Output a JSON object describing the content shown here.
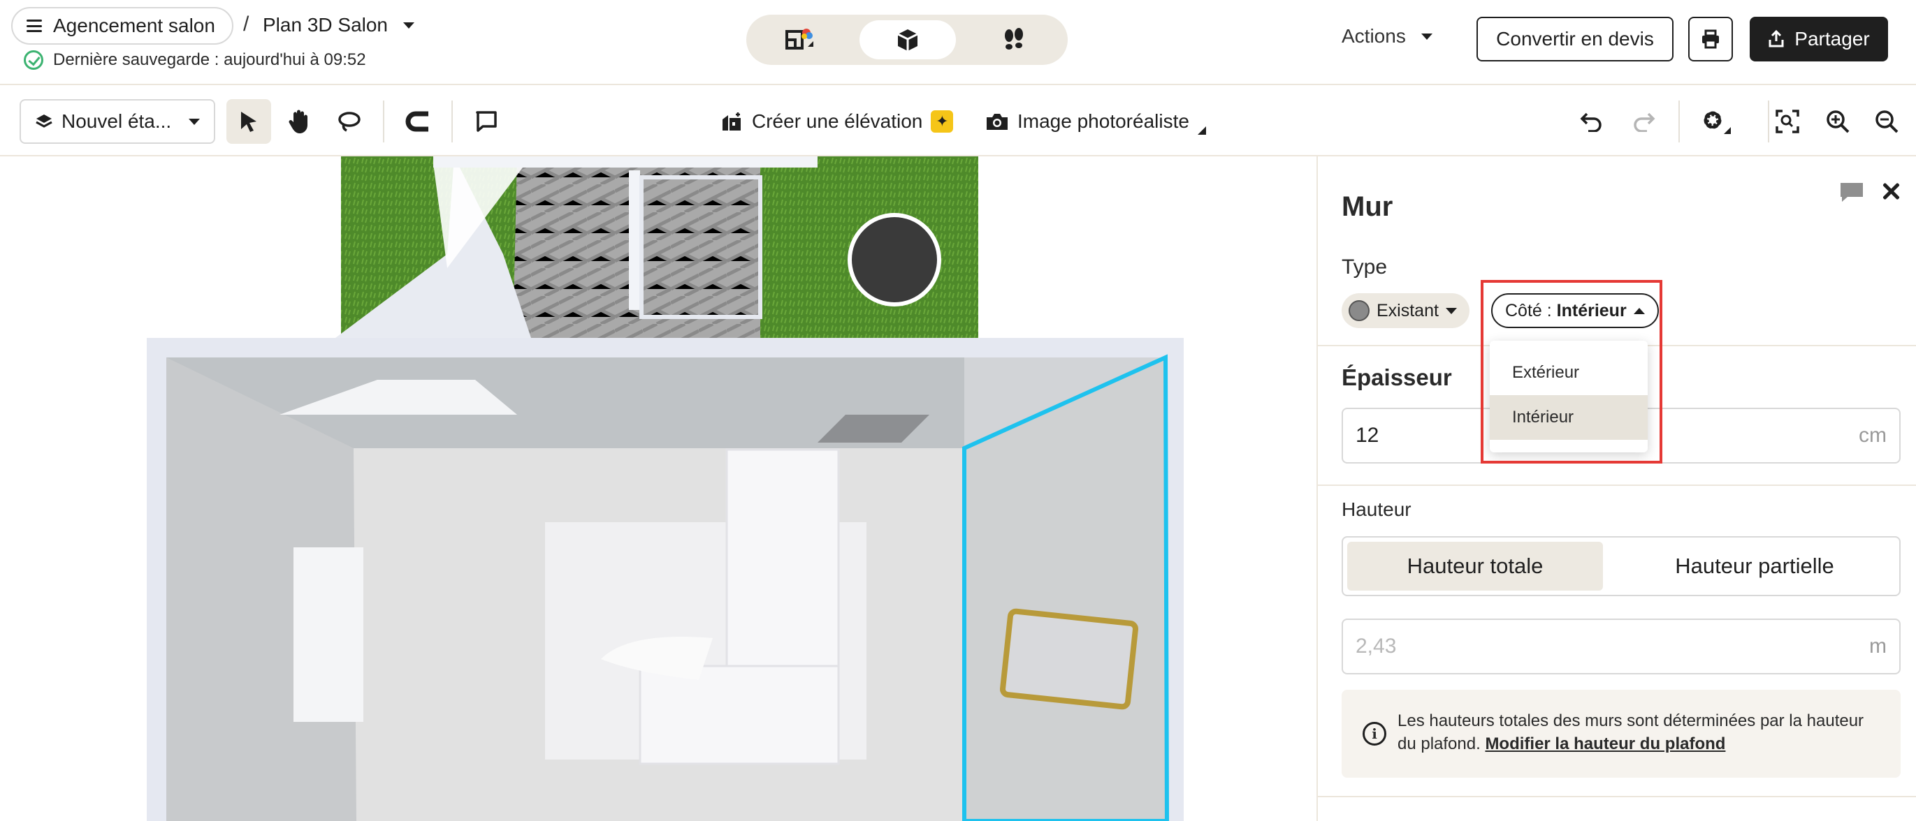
{
  "header": {
    "project_name": "Agencement salon",
    "separator": "/",
    "plan_name": "Plan 3D Salon",
    "save_status": "Dernière sauvegarde : aujourd'hui à 09:52",
    "actions_label": "Actions",
    "convert_label": "Convertir en devis",
    "share_label": "Partager"
  },
  "toolbar": {
    "floor_label": "Nouvel éta...",
    "elevation_label": "Créer une élévation",
    "photo_label": "Image photoréaliste"
  },
  "panel": {
    "title": "Mur",
    "type_label": "Type",
    "existing_label": "Existant",
    "side_prefix": "Côté : ",
    "side_value": "Intérieur",
    "side_options": [
      "Extérieur",
      "Intérieur"
    ],
    "thickness_label": "Épaisseur",
    "thickness_value": "12",
    "thickness_unit": "cm",
    "height_label": "Hauteur",
    "height_total_label": "Hauteur totale",
    "height_partial_label": "Hauteur partielle",
    "height_value": "2,43",
    "height_unit": "m",
    "info_text": "Les hauteurs totales des murs sont déterminées par la hauteur du plafond. ",
    "info_link": "Modifier la hauteur du plafond"
  },
  "colors": {
    "accent_dark": "#1f1f1f",
    "selection_wall": "#1ec2ee",
    "highlight": "#e53935",
    "save_ok": "#3cb371"
  }
}
